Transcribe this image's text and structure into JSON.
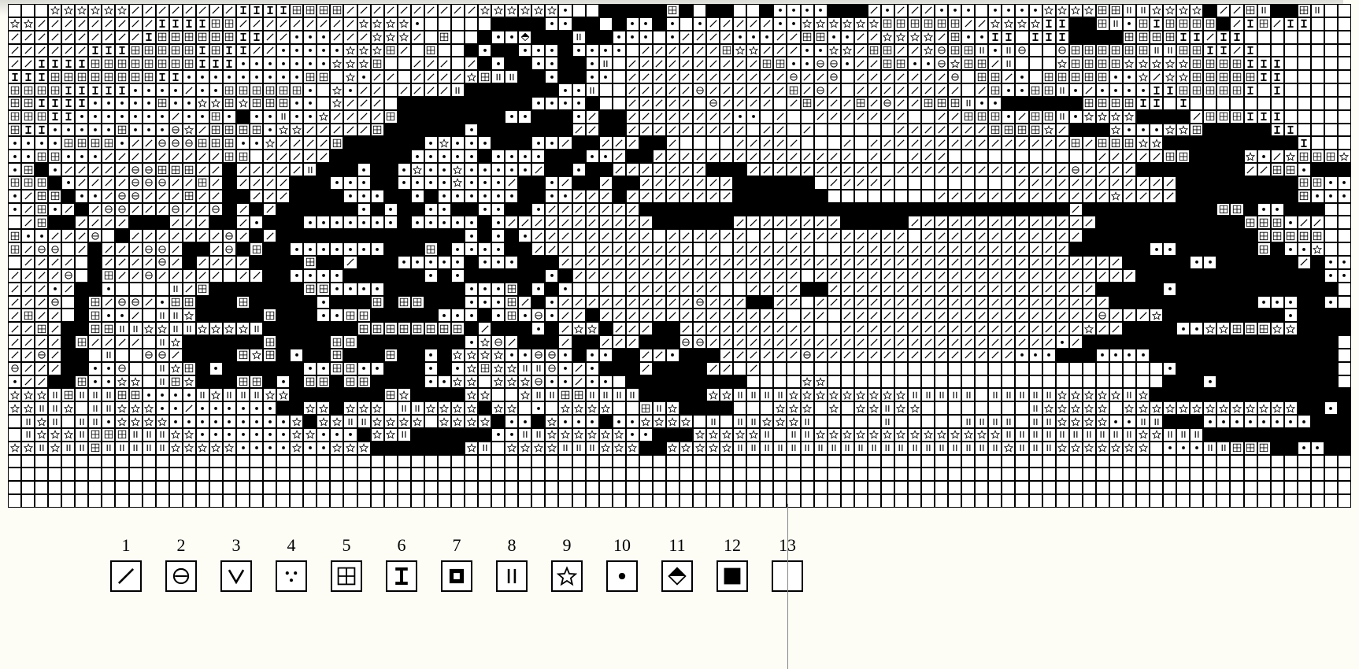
{
  "legend": [
    {
      "n": "1",
      "sym": "slash"
    },
    {
      "n": "2",
      "sym": "ominus"
    },
    {
      "n": "3",
      "sym": "vee"
    },
    {
      "n": "4",
      "sym": "dots"
    },
    {
      "n": "5",
      "sym": "plusbox"
    },
    {
      "n": "6",
      "sym": "ibar"
    },
    {
      "n": "7",
      "sym": "dotbox"
    },
    {
      "n": "8",
      "sym": "bars"
    },
    {
      "n": "9",
      "sym": "star"
    },
    {
      "n": "10",
      "sym": "dot"
    },
    {
      "n": "11",
      "sym": "diamond"
    },
    {
      "n": "12",
      "sym": "solid"
    },
    {
      "n": "13",
      "sym": "blank"
    }
  ],
  "grid": {
    "cols": 100,
    "rows": 38,
    "macro": [
      "   ssssssooooooooIIIIppppoooooooooossssssd  SSSSSpS SS  SddddSSSodoooddd ddddssssppbbssssSoopbSSpb ",
      "ssoooooooooIIIIppooooooooossssd     SSSSddSS SddSd doooooddssssssppppppoossssIISSpbdpIppppSoIpoII",
      "ooooooooooIppppppIIoodddooossso p  SddDSSSbSSddd doooodddooppddoossssopddII IIISSSSppppIIoII",
      "ooooooIIIpppppIpIIoodddddssspo p  SdSSdddSdddd oooooopssoooddssoppoosrppbdbr  rppppppbbppIIoI",
      "ooIIIIppppppppIIIdddddddsssp  ooo oSdSSddSSdb ooooooooooppddrrdooppddrsppob   sppppsssssppppIII",
      "IIIppppppppIIdddddddddpp sdoo oooospbbSSdSSdd ooooooooooooroor ooooooor ppod pppppddsosspppppII",
      "ppppIIIIIddddoddppppppd sdoo oooobSSSSSSSddb  ooooorooooooporo oooooooo opddppbdoddddIIpppppI I",
      "ppIIIIdddddpddsspspppdd sooo SSSSSSSSSSddddS  ooooo roooo opoooporoopppbddSSSSSSppppII I",
      "pppIIdddddddoddpdSddbddsoooopSSSSSSSSddSSSdoSSoooooooodd o  ooooooo  oopppdoppbdssssSSSSopppIII",
      "pIIdddddpdddrsoppppdssooooopSSSSSSdSSSSSSSooSSooooooooo oo o      oooooooppppsoSSSsdddsspSSSSSII",
      "ddddppppdoorrrpppddsoooopSSSSSSdsdddSSSddoSSoooSSo    ooooo   o ooooooooooooooopopppssSSSSSSSSSSI",
      "ddppdddooooooooopp oooooSSSSSSdddddSddddSSSddoSSooooooooooooooo oo ooo           oooooppSSSSsdosppps",
      "dpSdooooorrpppooSooooobSSSdSSdsddsdddddoSSdSSoooooooSSSoooooooooo ooooooooooooorooooSSSSSSSSooppdSSS",
      "pppSdoooorrroopoSooooSSSdddSSddddsdddoSSdoSSoSSoooooooSSSSSS ooooo         ooooooooooooSSSSSSSSSppdds",
      "doppSddorrooopooSSoooSSSSdddSSdSddddddSSddoooSooooooooSSSSSSS        ooooooooooooosooooSSSSSSSSSpddd",
      "dopdoSorroooroorSoSoSSSSSSdSdSSddSSddSSdoooooooSSSSSSSSSSSSSSSSSSSSSSSSSSSSSSSSoSSSSSSSSSSppSddSSS",
      " opSSooooSSSoooSSodSSSdddddddSdddddSdoooooooooooSSSSSSooooooooSSSSSooooooooooooooSSSSSSSSSSSpppdoo",
      "pddooor SoooooooroSoSSSSSSSSSSSSSSdSdSdooooooooo oooooo o ooooooooo ooooooooooooSSSSSSSSSSSSSppppp",
      "porr oSooorroSSorSpSSdddddddSSSpSddddSSooo oooooooo o oooooo  oooooooooooooooooSSSSSSddSSSSSSpSdds",
      " oooo SooooroSooooSSSSpSSoSSSdddddSdddSSSooooooooooooooooooooooooooooooooooooooooooSSSSSddSSSSSSoSdd",
      "oooor Spoorooooo ooSSddddSSSSSSdSdSSSSSSdSooooooooooooooooo ooooooooooooooooooooooooSSSSSSSSSSSSSSdd",
      "ooodoSSd    bopSSSSSSSppddddSSSSSSdddpSdSd  o ooooooo  ooooSSooooooooooooooooooooSSSSSdSSSSSSSSSSSS",
      "ooor SporrodppSSSpSSSSSdSSSpSppSSSdddpoSdooooooooooroooSSoo ooooooooooooooooooooooSSSSSSSSSSSdddSSd",
      "opoo Spddo bbsSSSSSpSSSddppSSSSSdddSdpdrdooSoooooooooooooo oo ooooooooooooooooooorooosSSSSSSSSSdSSSSS",
      "oopoSSppbbssbbssssbSSSSSSSppppppppSoSSSdSossSoooSSoooooooooo  oooooooooooooooooosooSSSSddsspppssSSSSS",
      "ooooSpoooo bsSSSSSSpSSSSppSSSSSSSSdsroSSSoSSoooSSSrroooooooooooooooooooooooooodoSSSSSSSSSSSSSSSSSSS",
      "ooroSS b  rroSSSSpspSdSSpSSSpSSdSssssddrrdSddSSoodSSSoooooorooooooooooooooodddSSSddddSSSSSSSSSSSSSS",
      "roooSSddr  bspSdSSSSSSddppddSSSdSdspssbbrdodSSSoSSSSoo o                              dSSSSSSSSSSSS",
      "dooSSpddss bpsSSSppSdSppSppSSSSddss sssrddodd SSSSSSSSS    ss                         SSSdSSSSSSSSS",
      "sssbpbbbppddddbsbbbssSSSSSSSpsSSSSss  sbbppbbbbSSSSSssbbbbsssssssssbbbbb bbbbbsssssbsSSSSSSSSSSSSSSSS",
      "ssbbs bbsssddoddddddSSssSsss bbssssSss d ssss  pbsSSSS   sss s ssbss        bsssss sssssssssssssSSdSS",
      " bsb bbdssssdddddddddsSssbbssss ssssSddSsdddSddssss b bbsssb     b     bbbb bbssssddbbSSSddddddddSSSS",
      " bsssbpppbbbssdddddddssdddSssbSSSSSSddbbssssssddSSSsssssb bbssssssssssssssbbbbbbbbbbssbbbSSSSSSSSSSSS",
      "ssbsbbpbbbbbsssssddddsddsssSSSSSSSsb ssssbbbsssSSsssssbbbbbbbbbbbbbbbbbbbbsbbbsssssss dddbbpppSSddSSSS",
      "                                                                                                    ",
      "                                                                                                    ",
      "                                                                                                    ",
      "                                                                                                    "
    ],
    "sym_map": {
      " ": "blank",
      "o": "slash",
      "r": "ominus",
      "d": "dot",
      "p": "plusbox",
      "I": "ibar",
      "S": "solid",
      "s": "star",
      "b": "bars",
      "D": "diamond",
      "x": "dotbox",
      "v": "vee",
      "c": "dots"
    }
  }
}
